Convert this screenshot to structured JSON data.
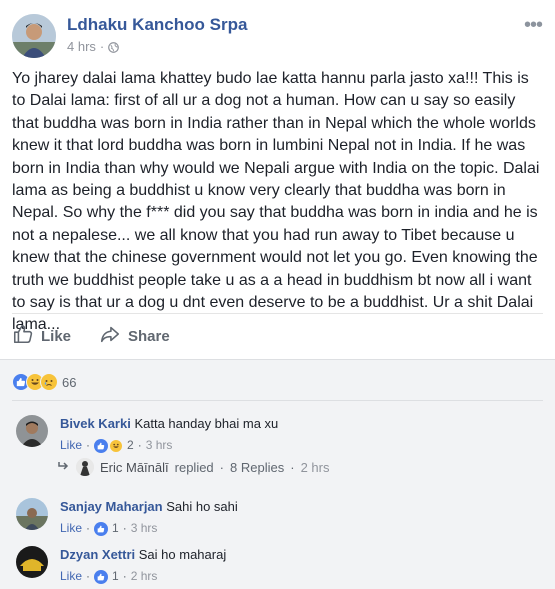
{
  "post": {
    "author": "Ldhaku Kanchoo Srpa",
    "time": "4 hrs",
    "dot": "·",
    "body": "Yo jharey dalai lama khattey budo lae katta hannu parla jasto xa!!! This is to Dalai lama: first of all ur a dog not a human. How can u say so easily that buddha was born in India rather than in Nepal which the whole worlds knew it that lord buddha was born in lumbini Nepal not in India. If he was born in India than why would we Nepali argue with India on the topic. Dalai lama as being a buddhist u know very clearly that buddha was born in Nepal. So why the f*** did you say that buddha was born in india and he is not a nepalese... we all know that you had run away to Tibet because u knew that the chinese government would not let you go. Even knowing the truth we buddhist people take u as a a head in buddhism bt now all i want to say is that ur a dog u dnt even deserve to be a buddhist. Ur a shit Dalai lama..."
  },
  "actions": {
    "like": "Like",
    "share": "Share"
  },
  "reactions": {
    "count": "66",
    "icons": [
      "like-reaction-icon",
      "haha-reaction-icon",
      "sad-reaction-icon"
    ]
  },
  "comments": [
    {
      "author": "Bivek Karki",
      "text": "Katta handay bhai ma xu",
      "like": "Like",
      "dot": "·",
      "reactions": "2",
      "time": "3 hrs"
    },
    {
      "author": "Sanjay Maharjan",
      "text": "Sahi ho sahi",
      "like": "Like",
      "dot": "·",
      "reactions": "1",
      "time": "3 hrs"
    },
    {
      "author": "Dzyan Xettri",
      "text": "Sai ho maharaj",
      "like": "Like",
      "dot": "·",
      "reactions": "1",
      "time": "2 hrs"
    }
  ],
  "reply": {
    "name": "Eric Māīnālī",
    "action": "replied",
    "dot": "·",
    "count": "8 Replies",
    "time": "2 hrs"
  },
  "colors": {
    "link": "#365899",
    "like_blue": "#4a7fee",
    "meta_gray": "#90949c",
    "comments_bg": "#f2f3f5"
  }
}
